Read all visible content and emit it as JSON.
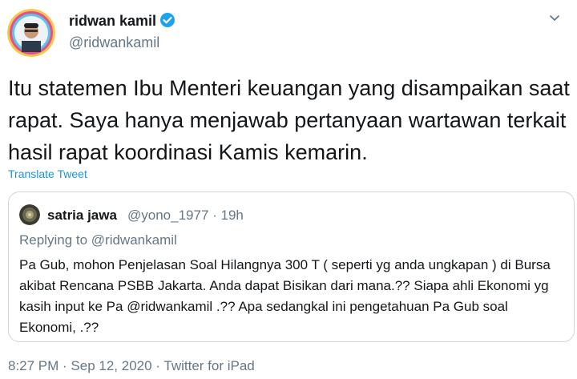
{
  "tweet": {
    "display_name": "ridwan kamil",
    "handle": "@ridwankamil",
    "text": "Itu statemen Ibu Menteri keuangan yang disampaikan saat rapat. Saya hanya menjawab pertanyaan wartawan terkait hasil rapat koordinasi Kamis kemarin.",
    "translate_label": "Translate Tweet",
    "time": "8:27 PM",
    "separator": " · ",
    "date": "Sep 12, 2020",
    "source": "Twitter for iPad"
  },
  "quote": {
    "display_name": "satria jawa",
    "handle": "@yono_1977",
    "separator": " · ",
    "age": "19h",
    "replying_to": "Replying to @ridwankamil",
    "text": "Pa Gub, mohon Penjelasan Soal Hilangnya 300 T  ( seperti yg anda ungkapan ) di Bursa akibat Rencana PSBB Jakarta. Anda dapat Bisikan dari mana.?? Siapa ahli Ekonomi yg kasih input ke Pa @ridwankamil  .?? Apa sedangkal ini pengetahuan Pa Gub soal Ekonomi, .??"
  },
  "colors": {
    "accent": "#1da1f2",
    "link": "#1b95e0",
    "secondary_text": "#657786",
    "border": "#ccd6dd"
  },
  "icons": {
    "verified": "verified-badge-icon",
    "caret": "chevron-down-icon"
  }
}
